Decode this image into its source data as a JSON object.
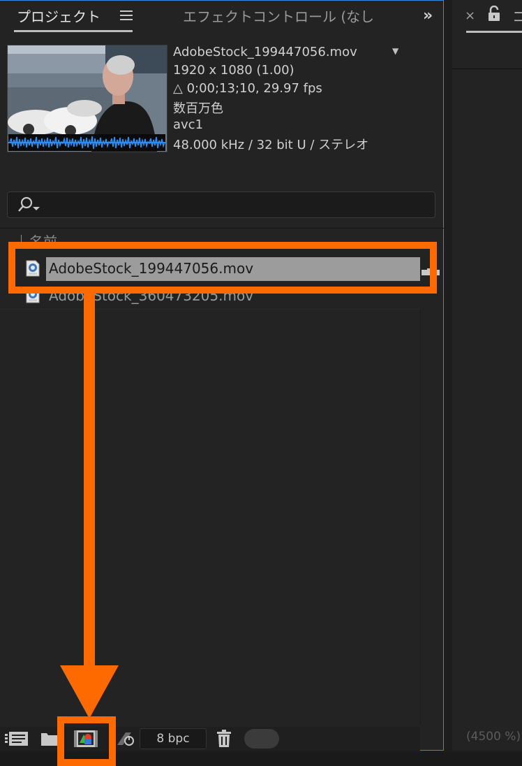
{
  "tabs": {
    "project": "プロジェクト",
    "effect_controls": "エフェクトコントロール (なし",
    "right_partial": "コ"
  },
  "footage_info": {
    "filename": "AdobeStock_199447056.mov",
    "resolution": "1920 x 1080 (1.00)",
    "duration": "△ 0;00;13;10, 29.97 fps",
    "colors": "数百万色",
    "codec": "avc1",
    "audio": "48.000 kHz / 32 bit U / ステレオ"
  },
  "search": {
    "placeholder": ""
  },
  "list": {
    "column_name": "名前",
    "items": [
      {
        "label": "AdobeStock_199447056.mov",
        "selected": true
      },
      {
        "label": "AdobeStock_360473205.mov",
        "selected": false
      }
    ]
  },
  "toolbar": {
    "bit_depth": "8 bpc"
  },
  "right_panel": {
    "zoom": "(4500 %)"
  },
  "colors": {
    "annotation": "#ff6a00",
    "panel_border": "#2d8ceb",
    "selection": "#9c9c9c",
    "waveform": "#2f8cf0"
  },
  "icons": [
    "menu-icon",
    "expand-icon",
    "close-icon",
    "lock-icon",
    "search-icon",
    "movie-file-icon",
    "interpret-footage-icon",
    "folder-icon",
    "new-composition-icon",
    "flowchart-icon",
    "trash-icon"
  ]
}
